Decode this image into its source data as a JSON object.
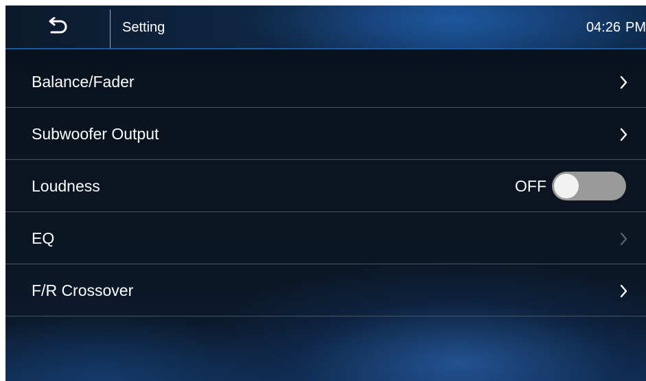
{
  "header": {
    "back_icon": "back-arrow-icon",
    "title": "Setting",
    "time": "04:26",
    "ampm": "PM"
  },
  "menu": {
    "items": [
      {
        "label": "Balance/Fader",
        "control": "chevron",
        "icon": "chevron-right-icon"
      },
      {
        "label": "Subwoofer Output",
        "control": "chevron",
        "icon": "chevron-right-icon"
      },
      {
        "label": "Loudness",
        "control": "toggle",
        "toggle_text": "OFF",
        "toggle_on": false
      },
      {
        "label": "EQ",
        "control": "chevron",
        "icon": "chevron-right-icon",
        "disabled": true
      },
      {
        "label": "F/R Crossover",
        "control": "chevron",
        "icon": "chevron-right-icon"
      }
    ]
  },
  "colors": {
    "chevron_enabled": "#ffffff",
    "chevron_disabled": "#5a6270",
    "toggle_track_off": "#9a9a9a",
    "toggle_knob": "#f2f2f2",
    "header_accent": "#1e5aa0"
  }
}
